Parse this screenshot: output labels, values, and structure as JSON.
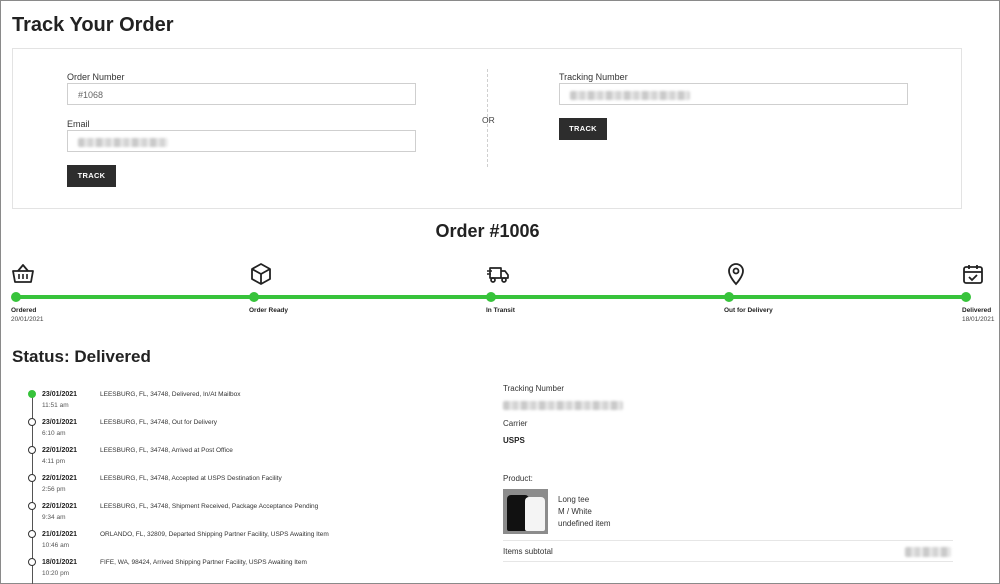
{
  "page": {
    "title": "Track Your Order"
  },
  "track_form": {
    "order_number_label": "Order Number",
    "order_number_value": "#1068",
    "email_label": "Email",
    "email_value": "",
    "track_button": "TRACK",
    "or_label": "OR",
    "tracking_number_label": "Tracking Number",
    "tracking_number_value": "",
    "tracking_track_button": "TRACK"
  },
  "order": {
    "title": "Order #1006",
    "accent_color": "#37c33b",
    "steps": [
      {
        "label": "Ordered",
        "date": "20/01/2021",
        "icon": "basket-icon"
      },
      {
        "label": "Order Ready",
        "date": "",
        "icon": "box-icon"
      },
      {
        "label": "In Transit",
        "date": "",
        "icon": "truck-icon"
      },
      {
        "label": "Out for Delivery",
        "date": "",
        "icon": "location-pin-icon"
      },
      {
        "label": "Delivered",
        "date": "18/01/2021",
        "icon": "calendar-check-icon"
      }
    ]
  },
  "status": {
    "title": "Status: Delivered",
    "events": [
      {
        "date": "23/01/2021",
        "time": "11:51 am",
        "desc": "LEESBURG, FL, 34748, Delivered, In/At Mailbox"
      },
      {
        "date": "23/01/2021",
        "time": "6:10 am",
        "desc": "LEESBURG, FL, 34748, Out for Delivery"
      },
      {
        "date": "22/01/2021",
        "time": "4:11 pm",
        "desc": "LEESBURG, FL, 34748, Arrived at Post Office"
      },
      {
        "date": "22/01/2021",
        "time": "2:56 pm",
        "desc": "LEESBURG, FL, 34748, Accepted at USPS Destination Facility"
      },
      {
        "date": "22/01/2021",
        "time": "9:34 am",
        "desc": "LEESBURG, FL, 34748, Shipment Received, Package Acceptance Pending"
      },
      {
        "date": "21/01/2021",
        "time": "10:46 am",
        "desc": "ORLANDO, FL, 32809, Departed Shipping Partner Facility, USPS Awaiting Item"
      },
      {
        "date": "18/01/2021",
        "time": "10:20 pm",
        "desc": "FIFE, WA, 98424, Arrived Shipping Partner Facility, USPS Awaiting Item"
      }
    ]
  },
  "details": {
    "tracking_label": "Tracking Number",
    "carrier_label": "Carrier",
    "carrier_value": "USPS",
    "product_label": "Product:",
    "product_name": "Long tee",
    "product_variant": "M / White",
    "product_extra": "undefined item",
    "subtotal_label": "Items subtotal"
  }
}
